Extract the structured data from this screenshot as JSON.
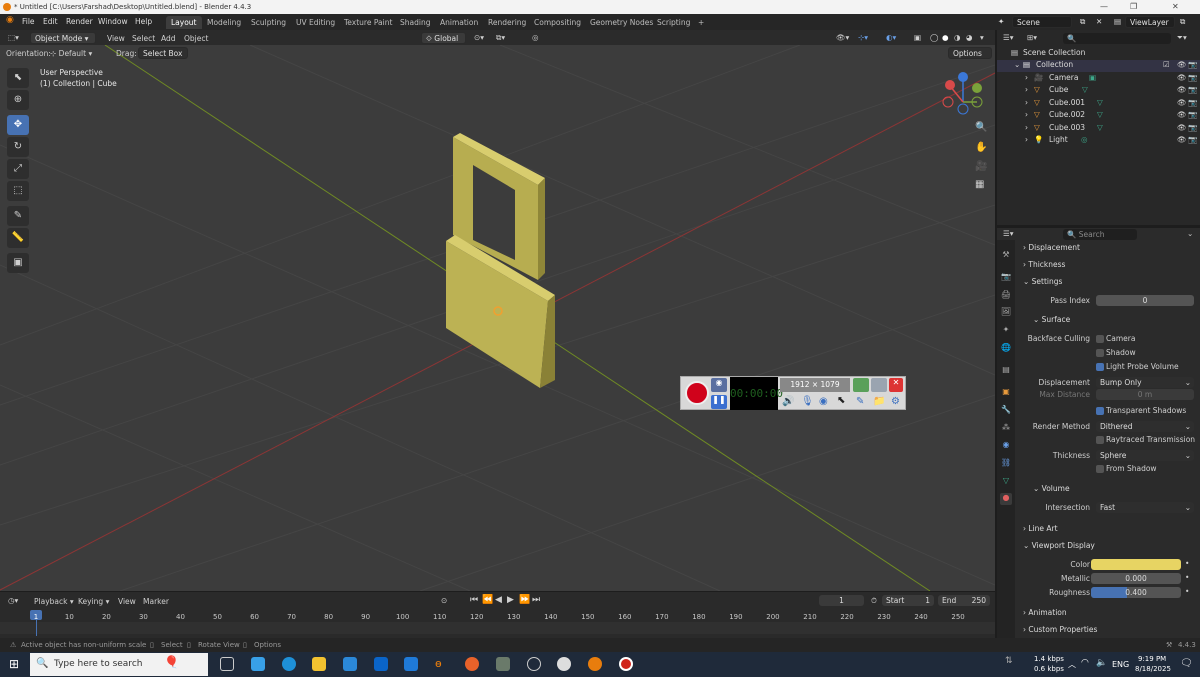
{
  "window": {
    "title": "* Untitled [C:\\Users\\Farshad\\Desktop\\Untitled.blend] - Blender 4.4.3"
  },
  "menubar": {
    "menus": [
      "File",
      "Edit",
      "Render",
      "Window",
      "Help"
    ],
    "workspaces": [
      "Layout",
      "Modeling",
      "Sculpting",
      "UV Editing",
      "Texture Paint",
      "Shading",
      "Animation",
      "Rendering",
      "Compositing",
      "Geometry Nodes",
      "Scripting"
    ],
    "add_tab": "+",
    "scene": "Scene",
    "viewlayer": "ViewLayer"
  },
  "viewport_header": {
    "mode": "Object Mode",
    "menus": [
      "View",
      "Select",
      "Add",
      "Object"
    ],
    "transform": "Global",
    "options": "Options"
  },
  "tool_settings": {
    "orientation_label": "Orientation:",
    "orientation": "Default",
    "drag_label": "Drag:",
    "drag": "Select Box"
  },
  "viewport": {
    "perspective": "User Perspective",
    "collection": "(1) Collection | Cube"
  },
  "recorder": {
    "resolution": "1912 × 1079",
    "timer": "00:00:00"
  },
  "outliner": {
    "search_placeholder": "",
    "root": "Scene Collection",
    "collection": "Collection",
    "items": [
      "Camera",
      "Cube",
      "Cube.001",
      "Cube.002",
      "Cube.003",
      "Light"
    ]
  },
  "properties": {
    "search_placeholder": "Search",
    "sections": {
      "displacement": "Displacement",
      "thickness": "Thickness",
      "settings": "Settings",
      "surface": "Surface",
      "volume": "Volume",
      "line_art": "Line Art",
      "viewport_display": "Viewport Display",
      "animation": "Animation",
      "custom_properties": "Custom Properties"
    },
    "pass_index_label": "Pass Index",
    "pass_index": "0",
    "backface_label": "Backface Culling",
    "camera": "Camera",
    "shadow": "Shadow",
    "light_probe": "Light Probe Volume",
    "displacement_label": "Displacement",
    "displacement_value": "Bump Only",
    "max_distance_label": "Max Distance",
    "max_distance": "0 m",
    "transparent_shadows": "Transparent Shadows",
    "render_method_label": "Render Method",
    "render_method": "Dithered",
    "raytraced": "Raytraced Transmission",
    "thickness_label": "Thickness",
    "thickness_value": "Sphere",
    "from_shadow": "From Shadow",
    "intersection_label": "Intersection",
    "intersection": "Fast",
    "color_label": "Color",
    "color": "#e7d463",
    "metallic_label": "Metallic",
    "metallic": "0.000",
    "roughness_label": "Roughness",
    "roughness": "0.400",
    "roughness_fraction": 0.4
  },
  "timeline": {
    "menus": [
      "Playback",
      "Keying",
      "View",
      "Marker"
    ],
    "current_frame": "1",
    "start_label": "Start",
    "start": "1",
    "end_label": "End",
    "end": "250",
    "ticks": [
      "1",
      "10",
      "20",
      "30",
      "40",
      "50",
      "60",
      "70",
      "80",
      "90",
      "100",
      "110",
      "120",
      "130",
      "140",
      "150",
      "160",
      "170",
      "180",
      "190",
      "200",
      "210",
      "220",
      "230",
      "240",
      "250"
    ]
  },
  "statusbar": {
    "warning": "Active object has non-uniform scale",
    "select": "Select",
    "rotate": "Rotate View",
    "options": "Options",
    "version": "4.4.3"
  },
  "taskbar": {
    "search_placeholder": "Type here to search",
    "net_up": "1.4 kbps",
    "net_down": "0.6 kbps",
    "lang": "ENG",
    "time": "9:19 PM",
    "date": "8/18/2025"
  },
  "colors": {
    "accent": "#4772b3",
    "object": "#c7b94f",
    "axis_x": "#b03a3a",
    "axis_y": "#7a9a2a"
  }
}
